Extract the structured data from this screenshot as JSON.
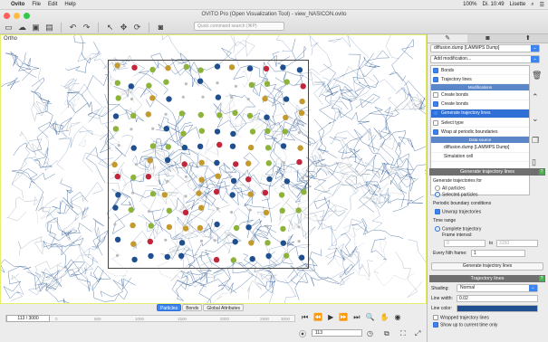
{
  "menubar": {
    "app": "Ovito",
    "items": [
      "File",
      "Edit",
      "Help"
    ],
    "battery": "100%",
    "clock": "Di. 10:49",
    "user": "Lisette"
  },
  "window": {
    "title": "OVITO Pro (Open Visualization Tool) - view_NASICON.ovito"
  },
  "search": {
    "placeholder": "Quick command search (⌘P)"
  },
  "viewport": {
    "label": "Ortho"
  },
  "pipeline": {
    "selector": "diffusion.dump [LAMMPS Dump]",
    "add_modification": "Add modification...",
    "items": [
      {
        "label": "Bonds",
        "checked": true,
        "type": "item"
      },
      {
        "label": "Trajectory lines",
        "checked": true,
        "type": "item"
      },
      {
        "label": "Modifications",
        "type": "header"
      },
      {
        "label": "Create bonds",
        "checked": false,
        "type": "item"
      },
      {
        "label": "Create bonds",
        "checked": true,
        "type": "item"
      },
      {
        "label": "Generate trajectory lines",
        "checked": true,
        "type": "selected"
      },
      {
        "label": "Select type",
        "checked": false,
        "type": "item"
      },
      {
        "label": "Wrap at periodic boundaries",
        "checked": true,
        "type": "item"
      },
      {
        "label": "Data source",
        "type": "header"
      },
      {
        "label": "diffusion.dump [LAMMPS Dump]",
        "type": "plain"
      },
      {
        "label": "Simulation cell",
        "type": "plain"
      }
    ]
  },
  "gen_panel": {
    "title": "Generate trajectory lines",
    "help": "?",
    "gen_for": "Generate trajectories for",
    "all_particles": "All particles",
    "selected_particles": "Selected particles",
    "pbc": "Periodic boundary conditions",
    "unwrap": "Unwrap trajectories",
    "time_range": "Time range",
    "complete": "Complete trajectory",
    "frame_interval": "Frame interval:",
    "from": "0",
    "to_label": "to",
    "to": "3150",
    "every_nth": "Every Nth frame:",
    "nth_value": "1",
    "button": "Generate trajectory lines"
  },
  "traj_panel": {
    "title": "Trajectory lines",
    "help": "?",
    "shading_label": "Shading:",
    "shading_value": "Normal",
    "width_label": "Line width:",
    "width_value": "0.02",
    "color_label": "Line color:",
    "line_color": "#1f4f8f",
    "wrapped": "Wrapped trajectory lines",
    "show_upto": "Show up to current time only"
  },
  "bottom": {
    "tabs": [
      "Particles",
      "Bonds",
      "Global Attributes"
    ],
    "frame": "113 / 3000",
    "ticks": [
      "0",
      "500",
      "1000",
      "1500",
      "2000",
      "2500",
      "3000"
    ],
    "spinner": "113"
  }
}
